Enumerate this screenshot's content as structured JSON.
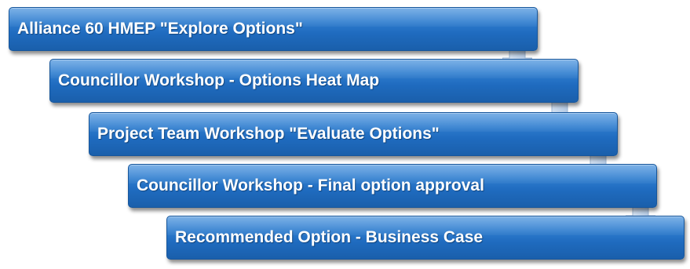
{
  "steps": [
    {
      "label": "Alliance 60 HMEP \"Explore Options\""
    },
    {
      "label": "Councillor Workshop - Options Heat Map"
    },
    {
      "label": "Project Team Workshop \"Evaluate Options\""
    },
    {
      "label": "Councillor Workshop  - Final  option approval"
    },
    {
      "label": "Recommended Option - Business Case"
    }
  ],
  "colors": {
    "box": "#2a77c9",
    "arrow": "#c9d9ec"
  }
}
